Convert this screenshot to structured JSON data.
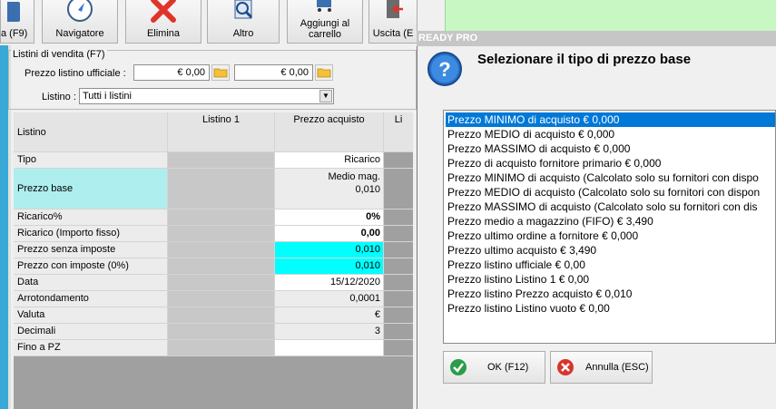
{
  "toolbar": {
    "buttons": [
      {
        "label": "a (F9)"
      },
      {
        "label": "Navigatore"
      },
      {
        "label": "Elimina"
      },
      {
        "label": "Altro"
      },
      {
        "label": "Aggiungi al carrello"
      },
      {
        "label": "Uscita (E"
      }
    ]
  },
  "panel": {
    "group_title": "Listini di vendita (F7)",
    "prezzo_listino_label": "Prezzo listino ufficiale :",
    "prezzo_value_1": "€ 0,00",
    "prezzo_value_2": "€ 0,00",
    "listino_label": "Listino :",
    "listino_selected": "Tutti i listini"
  },
  "grid": {
    "header": {
      "row_label": "Listino",
      "col1": "Listino 1",
      "col2": "Prezzo acquisto",
      "col3": "Li"
    },
    "rows": [
      {
        "label": "Tipo",
        "col2": "Ricarico"
      },
      {
        "label": "Prezzo base",
        "col2a": "Medio mag.",
        "col2b": "0,010"
      },
      {
        "label": "Ricarico%",
        "col2": "0%"
      },
      {
        "label": "Ricarico (Importo fisso)",
        "col2": "0,00"
      },
      {
        "label": "Prezzo senza imposte",
        "col2": "0,010"
      },
      {
        "label": "Prezzo con imposte (0%)",
        "col2": "0,010"
      },
      {
        "label": "Data",
        "col2": "15/12/2020"
      },
      {
        "label": "Arrotondamento",
        "col2": "0,0001"
      },
      {
        "label": "Valuta",
        "col2": "€"
      },
      {
        "label": "Decimali",
        "col2": "3"
      },
      {
        "label": "Fino a PZ",
        "col2": ""
      }
    ]
  },
  "dialog": {
    "title": "READY PRO",
    "heading": "Selezionare il tipo di prezzo base",
    "options": [
      "Prezzo MINIMO di acquisto € 0,000",
      "Prezzo MEDIO di acquisto € 0,000",
      "Prezzo MASSIMO di acquisto € 0,000",
      "Prezzo di acquisto fornitore primario € 0,000",
      "Prezzo MINIMO di acquisto (Calcolato solo su fornitori con dispo",
      "Prezzo MEDIO di acquisto (Calcolato solo su fornitori con dispon",
      "Prezzo MASSIMO di acquisto (Calcolato solo su fornitori con dis",
      "Prezzo medio a magazzino (FIFO) € 3,490",
      "Prezzo ultimo ordine a fornitore € 0,000",
      "Prezzo ultimo acquisto € 3,490",
      "Prezzo listino ufficiale € 0,00",
      "Prezzo listino Listino 1 € 0,00",
      "Prezzo listino Prezzo acquisto € 0,010",
      "Prezzo listino Listino vuoto € 0,00"
    ],
    "selected_index": 0,
    "ok_label": "OK (F12)",
    "cancel_label": "Annulla (ESC)"
  },
  "colors": {
    "highlight_cyan": "#00ffff",
    "prezzo_base_bg": "#aeeeee",
    "selection": "#0078d7"
  }
}
